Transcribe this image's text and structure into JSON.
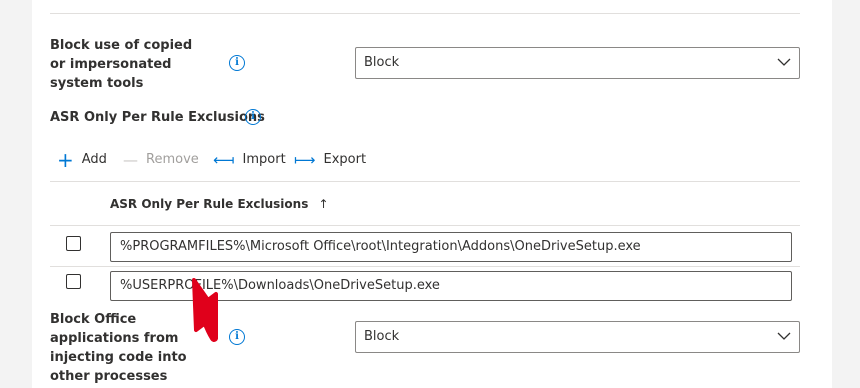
{
  "rule1": {
    "label": "Block use of copied or impersonated system tools",
    "select_value": "Block"
  },
  "exclusions_header": {
    "label": "ASR Only Per Rule Exclusions"
  },
  "toolbar": {
    "add_label": "Add",
    "remove_label": "Remove",
    "import_label": "Import",
    "export_label": "Export"
  },
  "table": {
    "column_header": "ASR Only Per Rule Exclusions",
    "sort_indicator": "↑",
    "rows": [
      {
        "value": "%PROGRAMFILES%\\Microsoft Office\\root\\Integration\\Addons\\OneDriveSetup.exe"
      },
      {
        "value": "%USERPROFILE%\\Downloads\\OneDriveSetup.exe"
      }
    ]
  },
  "rule2": {
    "label": "Block Office applications from injecting code into other processes",
    "select_value": "Block"
  },
  "annotation": {
    "arrow_color": "#e0001b"
  },
  "colors": {
    "accent": "#0078d4"
  },
  "icons": {
    "info": "info-icon",
    "add": "plus-icon",
    "remove": "minus-icon",
    "import": "import-arrow-icon",
    "export": "export-arrow-icon",
    "chevron": "chevron-down-icon"
  }
}
